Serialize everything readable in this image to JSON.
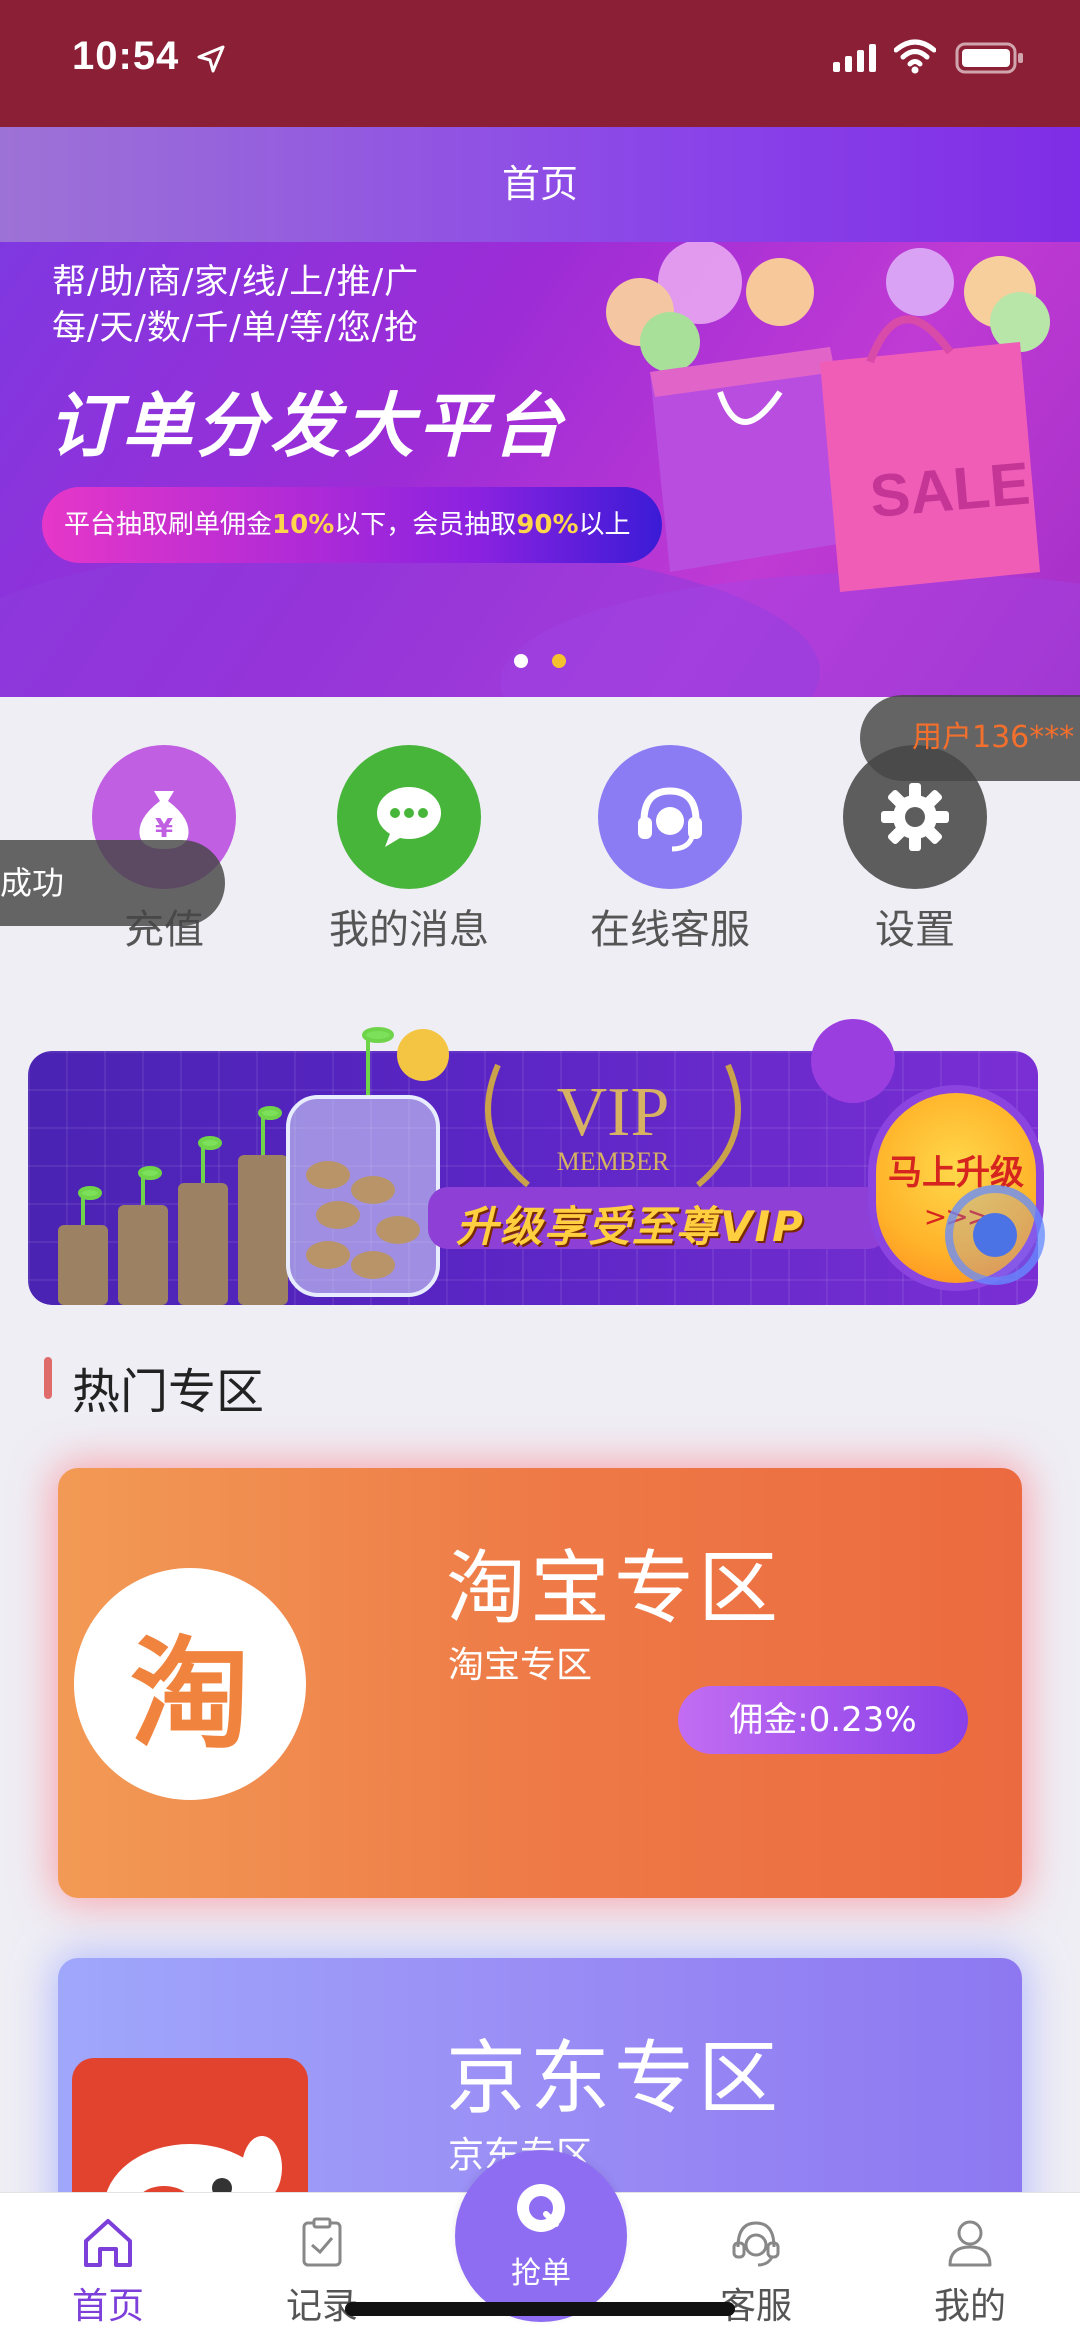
{
  "status_bar": {
    "time": "10:54"
  },
  "header": {
    "title": "首页"
  },
  "banner": {
    "line1": "帮/助/商/家/线/上/推/广",
    "line2": "每/天/数/千/单/等/您/抢",
    "title": "订单分发大平台",
    "pill_prefix": "平台抽取刷单佣金",
    "pill_rate1": "10%",
    "pill_middle": "以下，会员抽取",
    "pill_rate2": "90%",
    "pill_suffix": "以上",
    "sale_text": "SALE",
    "slides": 2,
    "active_slide": 2
  },
  "quick_actions": [
    {
      "label": "充值",
      "icon": "money-bag-icon"
    },
    {
      "label": "我的消息",
      "icon": "chat-bubble-icon"
    },
    {
      "label": "在线客服",
      "icon": "headset-icon"
    },
    {
      "label": "设置",
      "icon": "gear-icon"
    }
  ],
  "toasts": {
    "success": "成功",
    "user": "用户136***"
  },
  "vip_banner": {
    "vip_text": "VIP",
    "member_text": "MEMBER",
    "slogan": "升级享受至尊VIP",
    "upgrade_label": "马上升级",
    "arrows": ">>>"
  },
  "section": {
    "title": "热门专区"
  },
  "zones": [
    {
      "logo_text": "淘",
      "title": "淘宝专区",
      "subtitle": "淘宝专区",
      "commission": "佣金:0.23%"
    },
    {
      "title": "京东专区",
      "subtitle": "京东专区"
    }
  ],
  "tabbar": {
    "home": "首页",
    "records": "记录",
    "grab": "抢单",
    "service": "客服",
    "mine": "我的"
  },
  "colors": {
    "status_bar": "#8b1f36",
    "accent": "#7d3fd9",
    "taobao": "#ef7d48",
    "jd": "#9a8df5"
  }
}
